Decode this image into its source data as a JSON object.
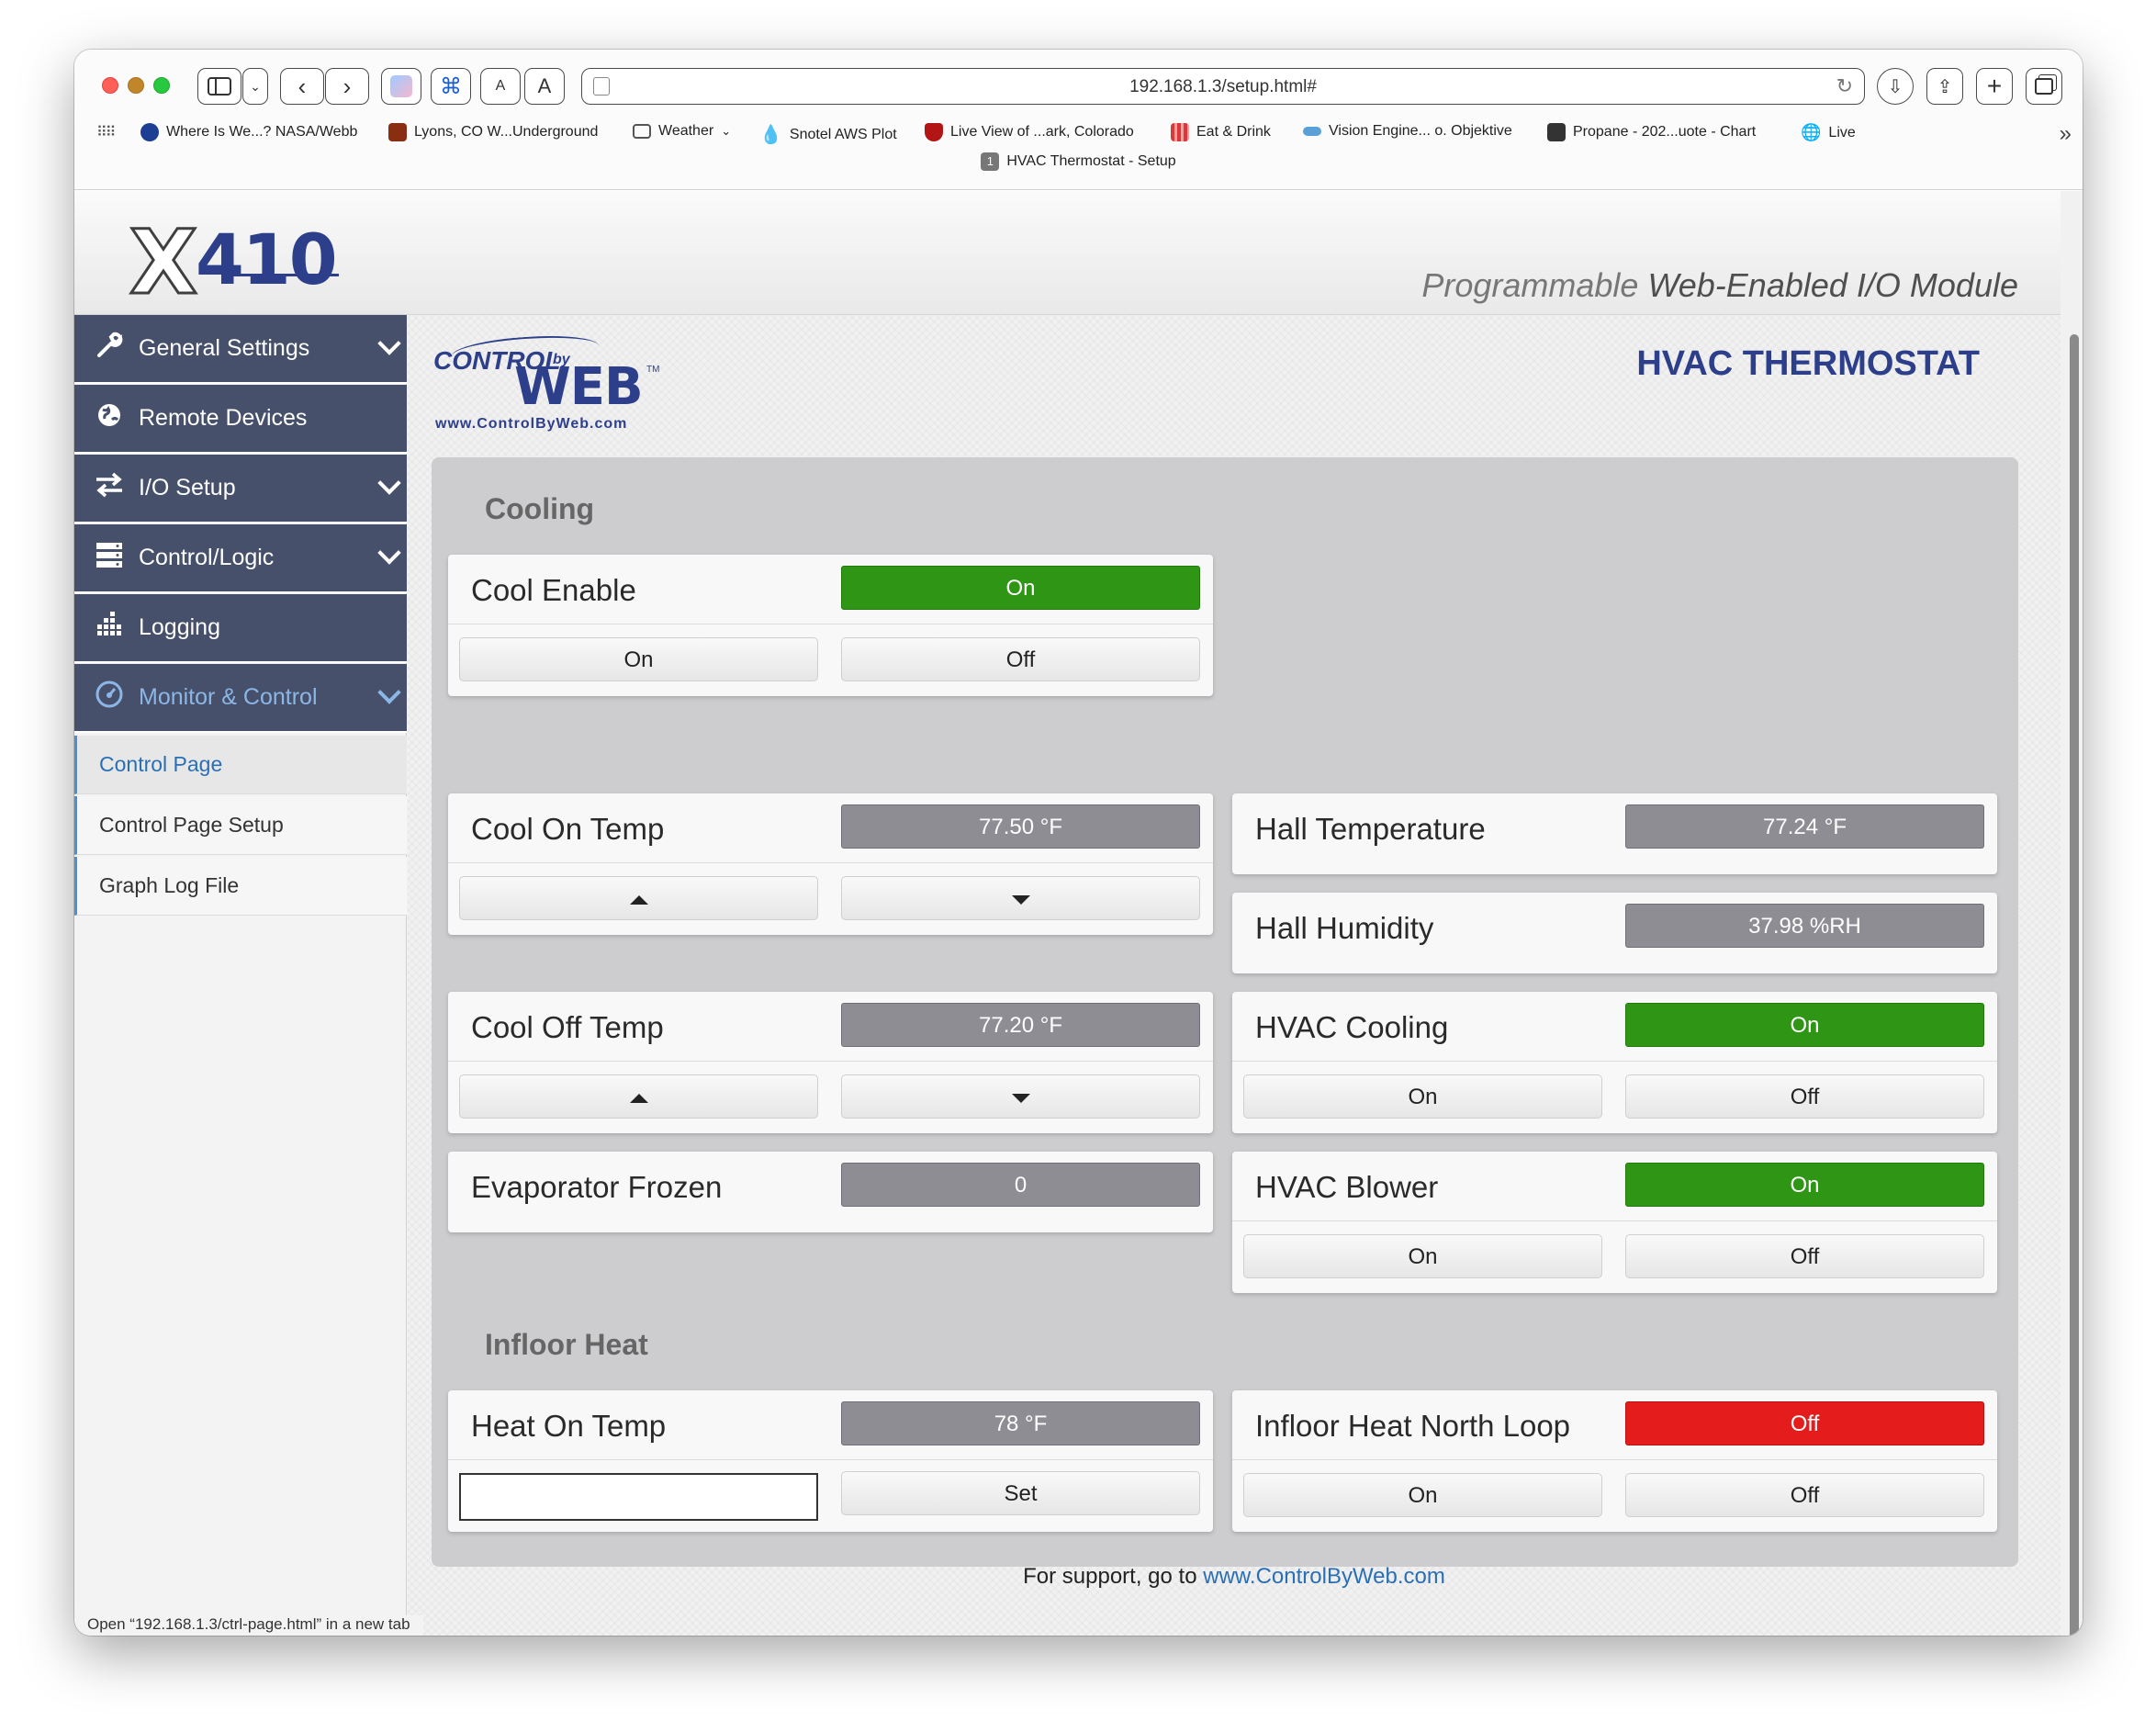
{
  "browser": {
    "url": "192.168.1.3/setup.html#",
    "tab_number": "1",
    "tab_title": "HVAC Thermostat - Setup",
    "bookmarks": [
      {
        "label": "Where Is We...? NASA/Webb",
        "icon": "nasa-icon",
        "color": "#1c3f94"
      },
      {
        "label": "Lyons, CO W...Underground",
        "icon": "wunderground-icon",
        "color": "#8a2e12"
      },
      {
        "label": "Weather",
        "icon": "folder-icon",
        "color": "#555555"
      },
      {
        "label": "Snotel AWS Plot",
        "icon": "droplet-icon",
        "color": "#1a7fc1"
      },
      {
        "label": "Live View of ...ark, Colorado",
        "icon": "shield-icon",
        "color": "#b31414"
      },
      {
        "label": "Eat & Drink",
        "icon": "grid-icon",
        "color": "#d83a3a"
      },
      {
        "label": "Vision Engine... o. Objektive",
        "icon": "cloud-icon",
        "color": "#5aa0d8"
      },
      {
        "label": "Propane - 202...uote - Chart",
        "icon": "propane-icon",
        "color": "#333333"
      },
      {
        "label": "Live",
        "icon": "globe-icon",
        "color": "#444444"
      }
    ],
    "status_text": "Open “192.168.1.3/ctrl-page.html” in a new tab"
  },
  "header": {
    "logo_x": "X",
    "logo_num": "410",
    "tagline_light": "Programmable ",
    "tagline_dark": "Web-Enabled I/O Module"
  },
  "sidebar": {
    "items": [
      {
        "label": "General Settings",
        "icon": "wrench-icon",
        "has_chevron": true
      },
      {
        "label": "Remote Devices",
        "icon": "globe-icon",
        "has_chevron": false
      },
      {
        "label": "I/O Setup",
        "icon": "arrows-icon",
        "has_chevron": true
      },
      {
        "label": "Control/Logic",
        "icon": "server-icon",
        "has_chevron": true
      },
      {
        "label": "Logging",
        "icon": "bars-icon",
        "has_chevron": false
      },
      {
        "label": "Monitor & Control",
        "icon": "gauge-icon",
        "has_chevron": true,
        "active": true
      }
    ],
    "subitems": [
      {
        "label": "Control Page",
        "selected": true
      },
      {
        "label": "Control Page Setup"
      },
      {
        "label": "Graph Log File"
      }
    ]
  },
  "main": {
    "brand": {
      "control": "CONTROL",
      "by": "by",
      "web": "WEB",
      "tm": "TM",
      "url": "www.ControlByWeb.com"
    },
    "title": "HVAC THERMOSTAT",
    "sections": {
      "cooling": "Cooling",
      "infloor": "Infloor Heat"
    },
    "cards": {
      "cool_enable": {
        "name": "Cool Enable",
        "value": "On",
        "on_label": "On",
        "off_label": "Off"
      },
      "cool_on_temp": {
        "name": "Cool On Temp",
        "value": "77.50 °F"
      },
      "hall_temperature": {
        "name": "Hall Temperature",
        "value": "77.24 °F"
      },
      "hall_humidity": {
        "name": "Hall Humidity",
        "value": "37.98 %RH"
      },
      "cool_off_temp": {
        "name": "Cool Off Temp",
        "value": "77.20 °F"
      },
      "hvac_cooling": {
        "name": "HVAC Cooling",
        "value": "On",
        "on_label": "On",
        "off_label": "Off"
      },
      "evaporator_frozen": {
        "name": "Evaporator Frozen",
        "value": "0"
      },
      "hvac_blower": {
        "name": "HVAC Blower",
        "value": "On",
        "on_label": "On",
        "off_label": "Off"
      },
      "heat_on_temp": {
        "name": "Heat On Temp",
        "value": "78 °F",
        "input_value": "",
        "set_label": "Set"
      },
      "infloor_north_loop": {
        "name": "Infloor Heat North Loop",
        "value": "Off",
        "on_label": "On",
        "off_label": "Off"
      }
    },
    "colors": {
      "on": "#2e9614",
      "off": "#e51c1c",
      "readout": "#8d8d93",
      "title": "#2d3f8a"
    }
  },
  "footer": {
    "support_text": "For support, go to ",
    "support_link": "www.ControlByWeb.com"
  }
}
